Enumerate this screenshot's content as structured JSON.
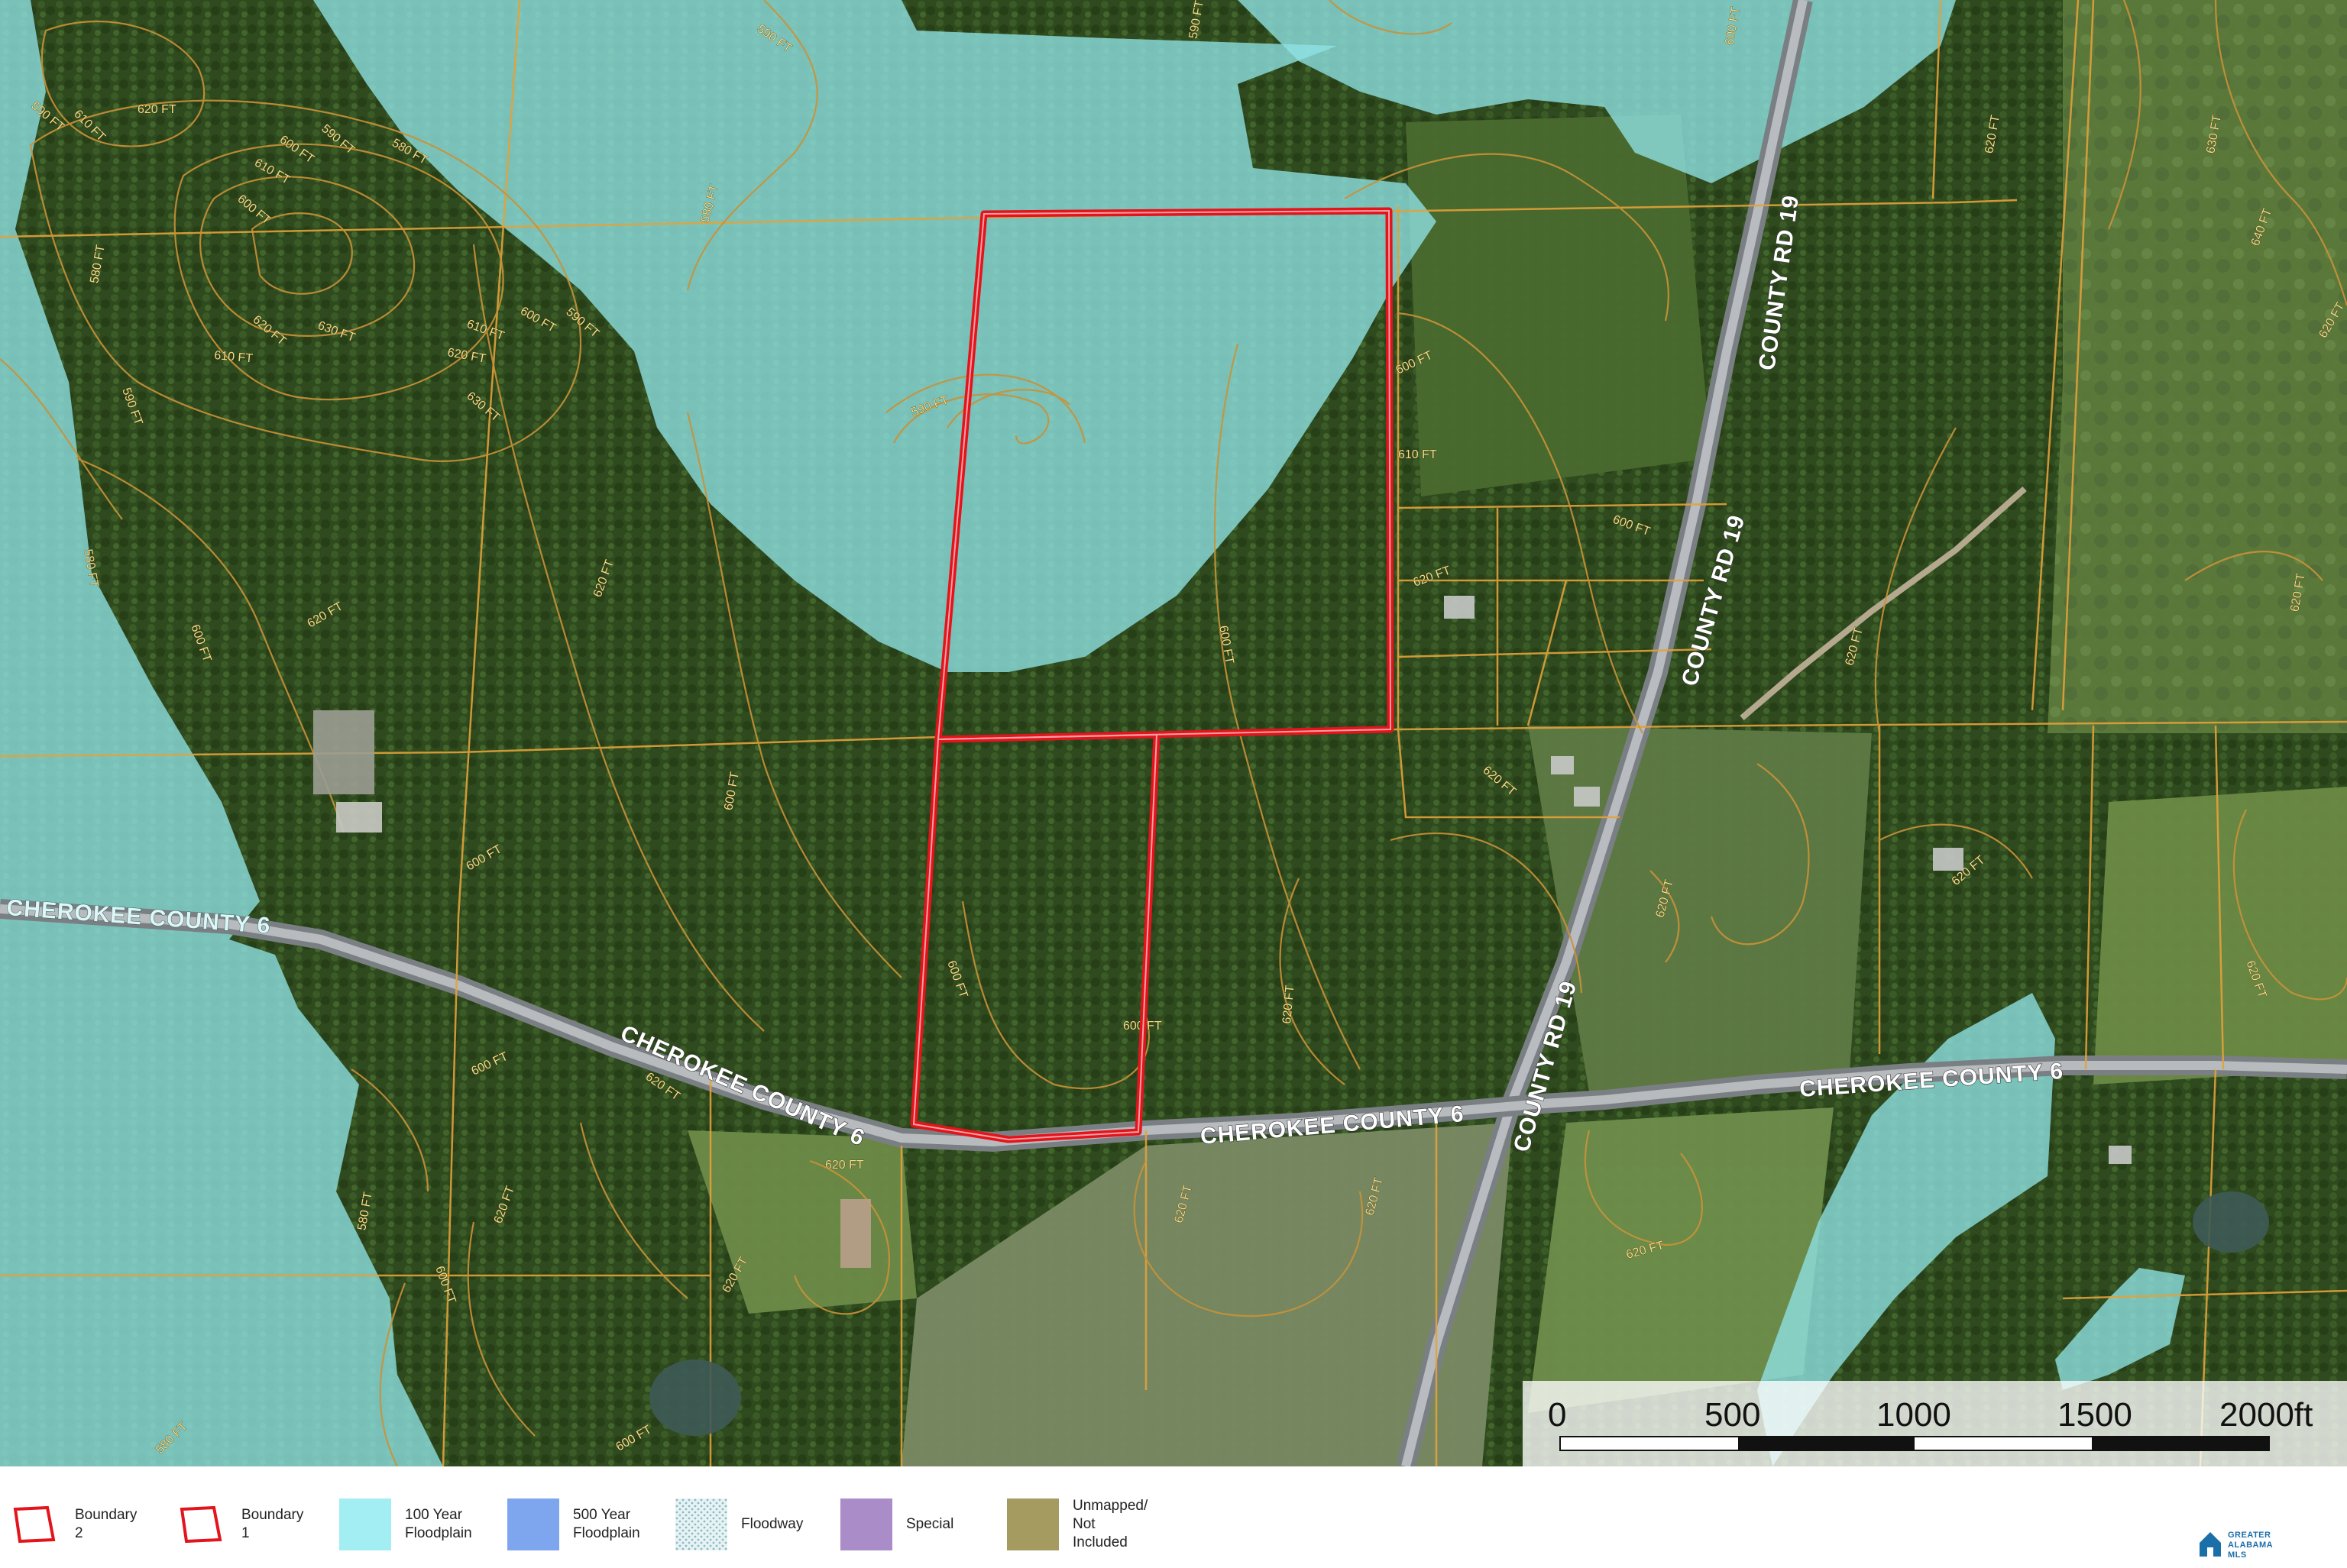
{
  "map": {
    "roads": {
      "county_6_label": "CHEROKEE COUNTY 6",
      "county_rd_19_label": "COUNTY RD 19"
    },
    "contours": [
      "580 FT",
      "590 FT",
      "600 FT",
      "610 FT",
      "620 FT",
      "630 FT",
      "640 FT"
    ],
    "contour_labels": {
      "c580": "580 FT",
      "c590": "590 FT",
      "c600": "600 FT",
      "c610": "610 FT",
      "c620": "620 FT",
      "c630": "630 FT",
      "c640": "640 FT"
    },
    "colors": {
      "boundary": "#e3141c",
      "floodplain_100": "#9eeaf0",
      "floodplain_500": "#7ea6ef",
      "contour": "#d49a3c",
      "parcel": "#e2a23a",
      "forest": "#2f4d1e"
    }
  },
  "scalebar": {
    "ticks": [
      "0",
      "500",
      "1000",
      "1500",
      "2000ft"
    ]
  },
  "legend": {
    "items": [
      {
        "label": "Boundary 2",
        "icon": "boundary-2-icon",
        "color": "#e3141c"
      },
      {
        "label": "Boundary 1",
        "icon": "boundary-1-icon",
        "color": "#e3141c"
      },
      {
        "label": "100 Year\nFloodplain",
        "icon": "floodplain-100-swatch",
        "color": "#a3eef3"
      },
      {
        "label": "500 Year\nFloodplain",
        "icon": "floodplain-500-swatch",
        "color": "#7ea6ef"
      },
      {
        "label": "Floodway",
        "icon": "floodway-swatch",
        "color": "#cfe4e8"
      },
      {
        "label": "Special",
        "icon": "special-swatch",
        "color": "#a98cc8"
      },
      {
        "label": "Unmapped/\nNot Included",
        "icon": "unmapped-swatch",
        "color": "#a59a5f"
      }
    ]
  },
  "brand": {
    "line1": "GREATER",
    "line2": "ALABAMA",
    "line3": "MLS"
  }
}
